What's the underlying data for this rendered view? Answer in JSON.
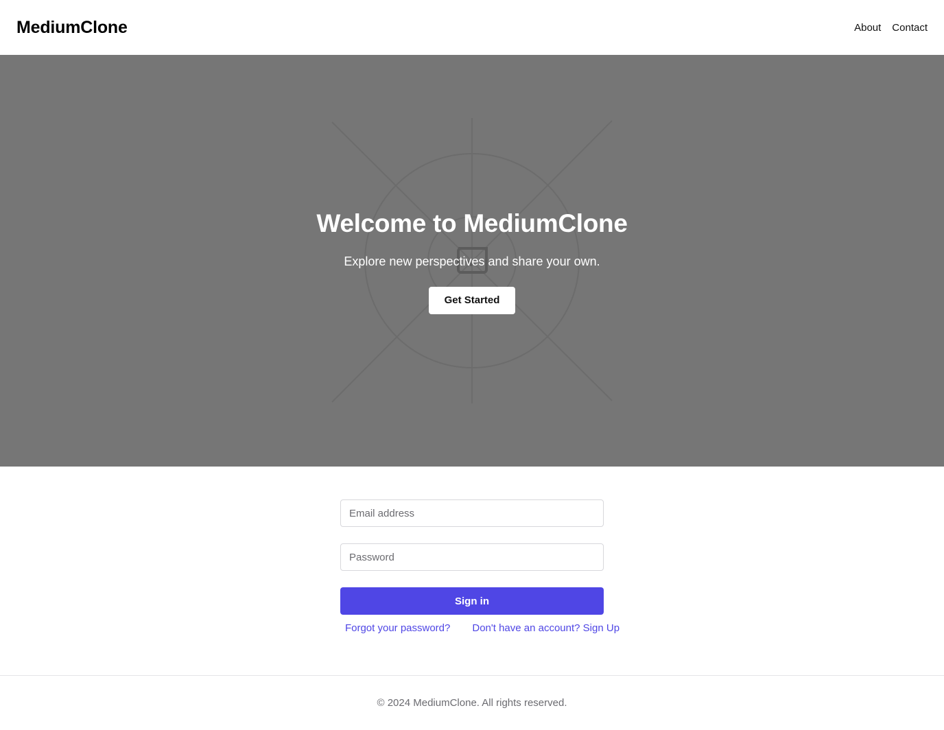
{
  "header": {
    "brand": "MediumClone",
    "nav": [
      {
        "label": "About"
      },
      {
        "label": "Contact"
      }
    ]
  },
  "hero": {
    "title": "Welcome to MediumClone",
    "subtitle": "Explore new perspectives and share your own.",
    "cta_label": "Get Started",
    "background_color": "#767676",
    "background_icon": "broken-image-icon"
  },
  "auth": {
    "email_placeholder": "Email address",
    "password_placeholder": "Password",
    "signin_label": "Sign in",
    "forgot_link": "Forgot your password?",
    "signup_link": "Don't have an account? Sign Up",
    "accent_color": "#4f46e5"
  },
  "footer": {
    "text": "© 2024 MediumClone. All rights reserved."
  }
}
